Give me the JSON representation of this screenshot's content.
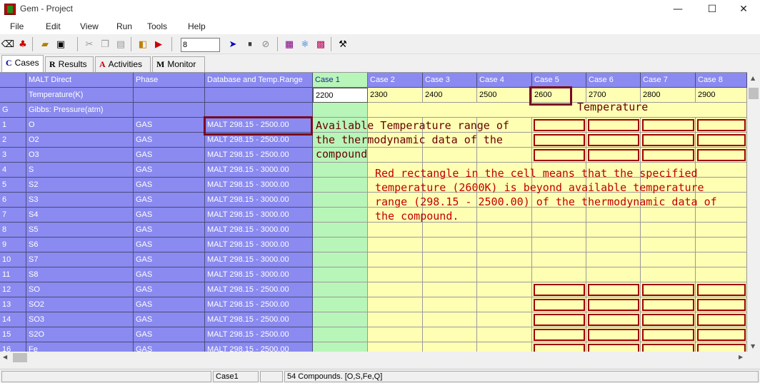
{
  "window": {
    "title": "Gem - Project"
  },
  "menu": [
    "File",
    "Edit",
    "View",
    "Run",
    "Tools",
    "Help"
  ],
  "toolbar": {
    "input_value": "8"
  },
  "tabs": [
    {
      "icon": "C",
      "label": "Cases",
      "active": true
    },
    {
      "icon": "R",
      "label": "Results"
    },
    {
      "icon": "A",
      "label": "Activities"
    },
    {
      "icon": "M",
      "label": "Monitor"
    }
  ],
  "grid": {
    "header": {
      "col1": "MALT Direct",
      "col2": "Phase",
      "col3": "Database and Temp.Range"
    },
    "cases": [
      "Case 1",
      "Case 2",
      "Case 3",
      "Case 4",
      "Case 5",
      "Case 6",
      "Case 7",
      "Case 8"
    ],
    "temp_label": "Temperature(K)",
    "temps": [
      "2200",
      "2300",
      "2400",
      "2500",
      "2600",
      "2700",
      "2800",
      "2900"
    ],
    "gibbs_label_g": "G",
    "gibbs_label": "Gibbs:   Pressure(atm)",
    "rows": [
      {
        "n": "1",
        "name": "O",
        "phase": "GAS",
        "db": "MALT 298.15 - 2500.00"
      },
      {
        "n": "2",
        "name": "O2",
        "phase": "GAS",
        "db": "MALT 298.15 - 2500.00"
      },
      {
        "n": "3",
        "name": "O3",
        "phase": "GAS",
        "db": "MALT 298.15 - 2500.00"
      },
      {
        "n": "4",
        "name": "S",
        "phase": "GAS",
        "db": "MALT 298.15 - 3000.00"
      },
      {
        "n": "5",
        "name": "S2",
        "phase": "GAS",
        "db": "MALT 298.15 - 3000.00"
      },
      {
        "n": "6",
        "name": "S3",
        "phase": "GAS",
        "db": "MALT 298.15 - 3000.00"
      },
      {
        "n": "7",
        "name": "S4",
        "phase": "GAS",
        "db": "MALT 298.15 - 3000.00"
      },
      {
        "n": "8",
        "name": "S5",
        "phase": "GAS",
        "db": "MALT 298.15 - 3000.00"
      },
      {
        "n": "9",
        "name": "S6",
        "phase": "GAS",
        "db": "MALT 298.15 - 3000.00"
      },
      {
        "n": "10",
        "name": "S7",
        "phase": "GAS",
        "db": "MALT 298.15 - 3000.00"
      },
      {
        "n": "11",
        "name": "S8",
        "phase": "GAS",
        "db": "MALT 298.15 - 3000.00"
      },
      {
        "n": "12",
        "name": "SO",
        "phase": "GAS",
        "db": "MALT 298.15 - 2500.00"
      },
      {
        "n": "13",
        "name": "SO2",
        "phase": "GAS",
        "db": "MALT 298.15 - 2500.00"
      },
      {
        "n": "14",
        "name": "SO3",
        "phase": "GAS",
        "db": "MALT 298.15 - 2500.00"
      },
      {
        "n": "15",
        "name": "S2O",
        "phase": "GAS",
        "db": "MALT 298.15 - 2500.00"
      },
      {
        "n": "16",
        "name": "Fe",
        "phase": "GAS",
        "db": "MALT 298.15 - 2500.00"
      }
    ]
  },
  "annotations": {
    "temperature": "Temperature",
    "range": "Available Temperature range of\nthe thermodynamic data of the\ncompound",
    "explanation": "Red rectangle in the cell means that the specified\ntemperature (2600K) is beyond available temperature\nrange (298.15 - 2500.00) of the thermodynamic data of\nthe compound."
  },
  "status": {
    "case": "Case1",
    "compounds": "54 Compounds. [O,S,Fe,Q]"
  },
  "colors": {
    "header_blue": "#8a8af0",
    "case1_green": "#b8f5b8",
    "case_yellow": "#ffffb4",
    "annotation_red": "#c00000"
  }
}
